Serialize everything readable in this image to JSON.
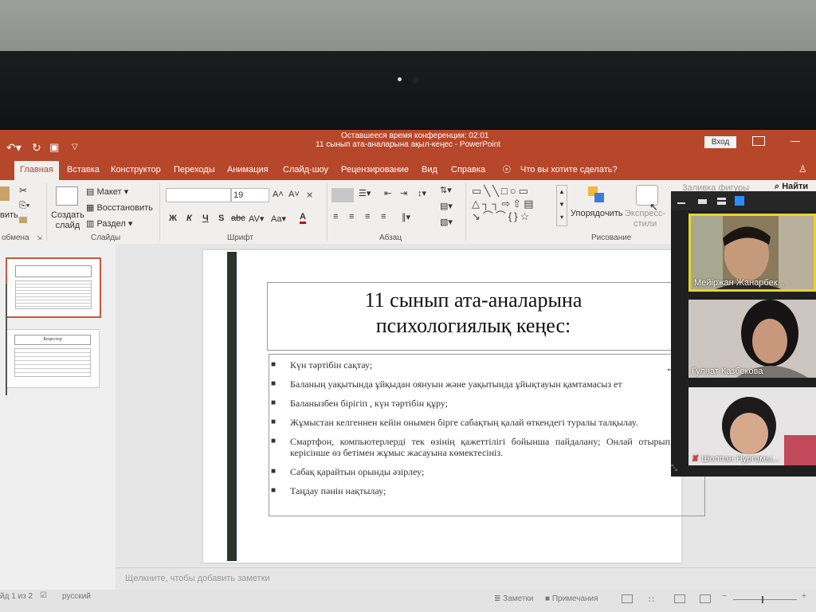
{
  "conference": {
    "time_left": "Оставшееся время конференции: 02:01"
  },
  "window": {
    "title": "11 сынып ата-аналарына ақыл-кеңес  -  PowerPoint",
    "signin": "Вход"
  },
  "ribbon_tabs": [
    "Главная",
    "Вставка",
    "Конструктор",
    "Переходы",
    "Анимация",
    "Слайд-шоу",
    "Рецензирование",
    "Вид",
    "Справка"
  ],
  "tell_me": "Что вы хотите сделать?",
  "ribbon": {
    "paste_label": "вить",
    "new_slide_label_1": "Создать",
    "new_slide_label_2": "слайд",
    "layout": "Макет",
    "reset": "Восстановить",
    "section": "Раздел",
    "font_size": "19",
    "arrange": "Упорядочить",
    "quick_styles_1": "Экспресс-",
    "quick_styles_2": "стили",
    "shape_fill": "Заливка фигуры",
    "find": "Найти",
    "groups": {
      "clipboard": "обмена",
      "slides": "Слайды",
      "font": "Шрифт",
      "paragraph": "Абзац",
      "drawing": "Рисование"
    }
  },
  "slide": {
    "title_line1": "11 сынып ата-аналарына",
    "title_line2": "психологиялық кеңес:",
    "bullets": [
      "Күн тәртібін сақтау;",
      "Баланың уақытында ұйқыдан оянуын және уақытында ұйықтауын қамтамасыз ет",
      "Баланызбен бірігіп , күн тәртібін құру;",
      "Жұмыстан келгеннен кейін онымен бірге сабақтың қалай өткендегі туралы талқылау.",
      "Смартфон, компьютерлерді тек өзінің қажеттілігі бойынша пайдалану; Онлай отырып, керісінше өз бетімен жұмыс жасауына көмектесініз.",
      "Сабақ қарайтын орынды әзірлеу;",
      "Таңдау пәнін нақтылау;"
    ]
  },
  "thumbnail_2_title": "Кеңестер",
  "notes_placeholder": "Щелкните, чтобы добавить заметки",
  "status": {
    "slide_count": "йд 1 из 2",
    "language": "русский",
    "notes": "Заметки",
    "comments": "Примечания"
  },
  "participants": [
    {
      "name": "Мейіржан Жанарбек..."
    },
    {
      "name": "Гулнат Казбекова"
    },
    {
      "name": "Шолпан Нургамы..."
    }
  ],
  "colors": {
    "ppt_red": "#b7472a",
    "active_speaker": "#e8d42a",
    "ribbon_bg": "#f0efee"
  }
}
